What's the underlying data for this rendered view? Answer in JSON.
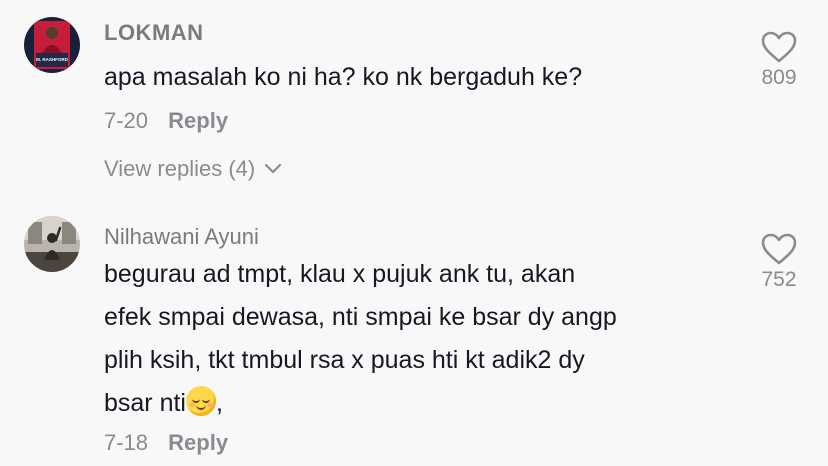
{
  "comments": [
    {
      "username": "LOKMAN",
      "avatar": "footballer-card-avatar",
      "avatar_caption": "M. RASHFORD",
      "text_lines": [
        "apa masalah ko ni ha? ko nk bergaduh ke?"
      ],
      "date": "7-20",
      "reply_label": "Reply",
      "view_replies": "View replies (4)",
      "likes": "809",
      "icon": "heart-outline-icon"
    },
    {
      "username": "Nilhawani Ayuni",
      "avatar": "silhouette-window-avatar",
      "text_lines": [
        "begurau ad tmpt, klau x pujuk ank tu, akan",
        "efek smpai dewasa, nti smpai ke bsar dy angp",
        "plih ksih, tkt tmbul rsa x puas hti kt adik2 dy",
        "bsar nti"
      ],
      "text_suffix": ",",
      "emoji": "relieved-face",
      "date": "7-18",
      "reply_label": "Reply",
      "likes": "752",
      "icon": "heart-outline-icon"
    }
  ],
  "colors": {
    "background": "#f8f8f8",
    "primary_text": "#161823",
    "secondary_text": "#8a8b91"
  }
}
